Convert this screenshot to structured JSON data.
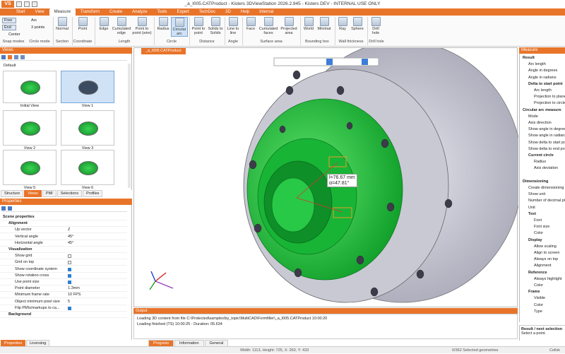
{
  "title": "_a_l005.CATProduct - Kisters 3DViewStation 2026.2.945 - Kisters DEV - INTERNAL USE ONLY",
  "logo": "VS",
  "menu": [
    "Start",
    "View",
    "Measure",
    "Transform",
    "Create",
    "Analyze",
    "Tools",
    "Expert",
    "TechDoc",
    "3D",
    "Help",
    "Internal"
  ],
  "ribbon": {
    "snap": {
      "free": "Free",
      "end": "End",
      "center": "Center",
      "arc": "Arc",
      "points3": "3 points",
      "group": "Snap modes"
    },
    "circle_mode": "Circle mode",
    "section": {
      "normal": "Normal",
      "group": "Section"
    },
    "coordinate": {
      "point": "Point",
      "group": "Coordinate"
    },
    "length": {
      "edge": "Edge",
      "cumulated": "Cumulated edge",
      "p2p": "Point to point (wire)",
      "group": "Length"
    },
    "circle": {
      "radius": "Radius",
      "circular": "Circular arc",
      "group": "Circle"
    },
    "distance": {
      "p2p": "Point to point",
      "s2s": "Solids to Solids",
      "group": "Distance"
    },
    "angle": {
      "l2l": "Line to line",
      "group": "Angle"
    },
    "surface": {
      "face": "Face",
      "cumulated": "Cumulated faces",
      "projected": "Projected area",
      "group": "Surface area"
    },
    "bbox": {
      "world": "World",
      "minimal": "Minimal",
      "group": "Bounding box"
    },
    "wall": {
      "ray": "Ray",
      "sphere": "Sphere",
      "group": "Wall thickness"
    },
    "drill": {
      "hole": "Drill hole",
      "group": "Drill hole"
    }
  },
  "views": {
    "header": "Views",
    "default": "Default",
    "thumbs": [
      "Initial View",
      "View 1",
      "View 2",
      "View 3",
      "View 5",
      "View 6"
    ],
    "tabs": [
      "Structure",
      "Views",
      "PMI",
      "Selections",
      "Profiles"
    ]
  },
  "properties": {
    "header": "Properties",
    "rows": [
      {
        "t": "top",
        "k": "Scene properties"
      },
      {
        "t": "cat",
        "k": "Alignment"
      },
      {
        "t": "row",
        "k": "Up vector",
        "v": "Z"
      },
      {
        "t": "row",
        "k": "Vertical angle",
        "v": "45°"
      },
      {
        "t": "row",
        "k": "Horizontal angle",
        "v": "45°"
      },
      {
        "t": "cat",
        "k": "Visualization"
      },
      {
        "t": "cb",
        "k": "Show grid",
        "on": false
      },
      {
        "t": "cb",
        "k": "Grid on top",
        "on": false
      },
      {
        "t": "cb",
        "k": "Show coordinate system",
        "on": true
      },
      {
        "t": "cb",
        "k": "Show rotation cross",
        "on": true
      },
      {
        "t": "cb",
        "k": "Use point size",
        "on": true
      },
      {
        "t": "row",
        "k": "Point diameter",
        "v": "1.3mm"
      },
      {
        "t": "row",
        "k": "Minimum frame rate",
        "v": "10 FPS"
      },
      {
        "t": "row",
        "k": "Object minimum pixel size",
        "v": "5"
      },
      {
        "t": "cb",
        "k": "Flip PMIs/markups to ca...",
        "on": true
      },
      {
        "t": "cat",
        "k": "Background"
      }
    ],
    "tabs": [
      "Properties",
      "Licensing"
    ]
  },
  "doc_tab": "_a_l005.CATProduct",
  "measure_label": {
    "length": "l=76.67 mm",
    "angle": "α=47.81°"
  },
  "output": {
    "header": "Output",
    "lines": [
      "Loading 3D content from file C:\\Protected\\samples\\by_topic\\MultiCAD\\Formfiller\\_a_l005.CATProduct 10:00:20",
      "Loading finished (TS) 10:00:25 - Duration: 05.634"
    ],
    "tabs": [
      "Progress",
      "Information",
      "General"
    ]
  },
  "measure_panel": {
    "header": "Measure",
    "rows": [
      {
        "t": "cat",
        "k": "Result",
        "i": 4
      },
      {
        "t": "row",
        "k": "Arc length",
        "i": 12
      },
      {
        "t": "row",
        "k": "Angle in degrees",
        "i": 12
      },
      {
        "t": "row",
        "k": "Angle in radians",
        "i": 12
      },
      {
        "t": "cat",
        "k": "Delta to start point",
        "i": 12
      },
      {
        "t": "row",
        "k": "Arc length",
        "i": 20
      },
      {
        "t": "row",
        "k": "Projection to plane",
        "i": 20
      },
      {
        "t": "row",
        "k": "Projection to circle",
        "i": 20
      },
      {
        "t": "cat",
        "k": "Circular arc measure",
        "i": 4
      },
      {
        "t": "row",
        "k": "Mode",
        "i": 12
      },
      {
        "t": "row",
        "k": "Axis direction",
        "i": 12
      },
      {
        "t": "row",
        "k": "Show angle in degrees",
        "i": 12
      },
      {
        "t": "row",
        "k": "Show angle in radians",
        "i": 12
      },
      {
        "t": "row",
        "k": "Show delta to start point",
        "i": 12
      },
      {
        "t": "row",
        "k": "Show delta to end point",
        "i": 12
      },
      {
        "t": "cat",
        "k": "Current circle",
        "i": 12
      },
      {
        "t": "row",
        "k": "Radius",
        "i": 20
      },
      {
        "t": "row",
        "k": "Axis deviation",
        "i": 20
      },
      {
        "t": "gap",
        "k": "",
        "i": 0
      },
      {
        "t": "cat",
        "k": "Dimensioning",
        "i": 4
      },
      {
        "t": "row",
        "k": "Create dimensioning",
        "i": 12
      },
      {
        "t": "row",
        "k": "Show unit",
        "i": 12
      },
      {
        "t": "row",
        "k": "Number of decimal places",
        "i": 12
      },
      {
        "t": "row",
        "k": "Unit",
        "i": 12
      },
      {
        "t": "cat",
        "k": "Text",
        "i": 12
      },
      {
        "t": "row",
        "k": "Font",
        "i": 20
      },
      {
        "t": "row",
        "k": "Font size",
        "i": 20
      },
      {
        "t": "row",
        "k": "Color",
        "i": 20
      },
      {
        "t": "cat",
        "k": "Display",
        "i": 12
      },
      {
        "t": "row",
        "k": "Allow scaling",
        "i": 20
      },
      {
        "t": "row",
        "k": "Align to screen",
        "i": 20
      },
      {
        "t": "row",
        "k": "Always on top",
        "i": 20
      },
      {
        "t": "row",
        "k": "Alignment",
        "i": 20
      },
      {
        "t": "cat",
        "k": "Reference",
        "i": 12
      },
      {
        "t": "row",
        "k": "Always highlight",
        "i": 20
      },
      {
        "t": "row",
        "k": "Color",
        "i": 20
      },
      {
        "t": "cat",
        "k": "Frame",
        "i": 12
      },
      {
        "t": "row",
        "k": "Visible",
        "i": 20
      },
      {
        "t": "row",
        "k": "Color",
        "i": 20
      },
      {
        "t": "row",
        "k": "Type",
        "i": 20
      }
    ],
    "result_title": "Result / next selection",
    "result_text": "Select a point."
  },
  "status": {
    "coords": "Width: 1113, Height: 725, X: 260, Y: 433",
    "selected": "0/362 Selected geometries",
    "right": "Cellsk"
  },
  "colors": {
    "accent": "#e8742a",
    "highlight": "#22c94a"
  }
}
